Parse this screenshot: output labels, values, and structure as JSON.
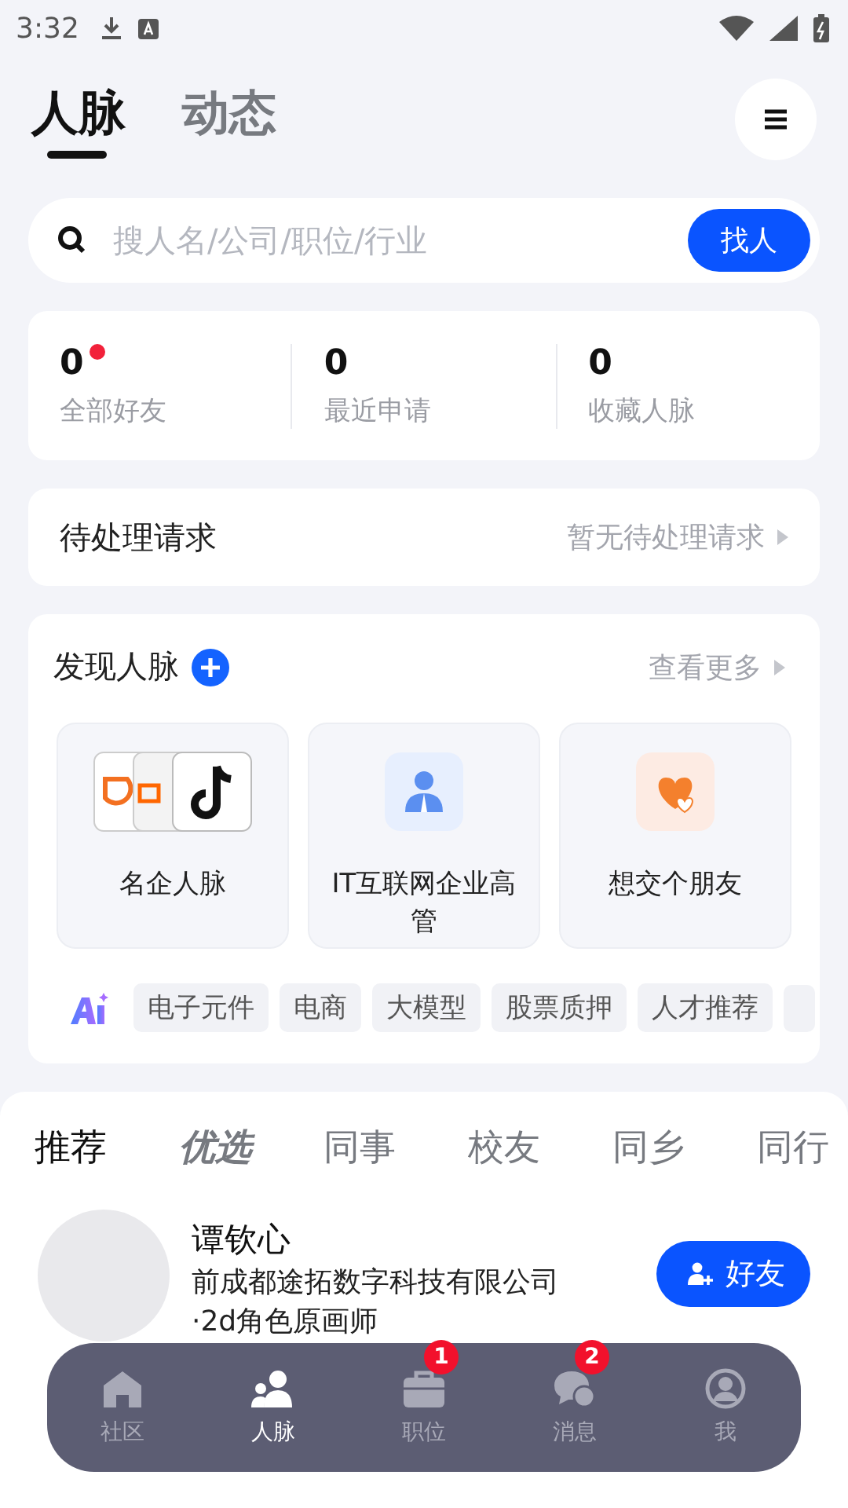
{
  "status_bar": {
    "time": "3:32"
  },
  "top_tabs": [
    {
      "label": "人脉",
      "selected": true
    },
    {
      "label": "动态",
      "selected": false
    }
  ],
  "search": {
    "placeholder": "搜人名/公司/职位/行业",
    "button": "找人"
  },
  "stats": [
    {
      "value": "0",
      "label": "全部好友",
      "dot": true
    },
    {
      "value": "0",
      "label": "最近申请",
      "dot": false
    },
    {
      "value": "0",
      "label": "收藏人脉",
      "dot": false
    }
  ],
  "pending": {
    "title": "待处理请求",
    "status": "暂无待处理请求"
  },
  "discover": {
    "title": "发现人脉",
    "more": "查看更多",
    "cards": [
      {
        "kind": "logos",
        "label": "名企人脉"
      },
      {
        "kind": "executive",
        "label": "IT互联网企业高管"
      },
      {
        "kind": "hearts",
        "label": "想交个朋友"
      }
    ],
    "tags": [
      "电子元件",
      "电商",
      "大模型",
      "股票质押",
      "人才推荐"
    ]
  },
  "feed_tabs": [
    {
      "label": "推荐",
      "selected": true,
      "kind": "plain"
    },
    {
      "label": "优选",
      "selected": false,
      "kind": "featured"
    },
    {
      "label": "同事",
      "selected": false,
      "kind": "plain"
    },
    {
      "label": "校友",
      "selected": false,
      "kind": "plain"
    },
    {
      "label": "同乡",
      "selected": false,
      "kind": "plain"
    },
    {
      "label": "同行",
      "selected": false,
      "kind": "plain"
    }
  ],
  "person": {
    "name": "谭钦心",
    "company": "前成都途拓数字科技有限公司",
    "role": "·2d角色原画师",
    "button": "好友"
  },
  "nav": [
    {
      "label": "社区",
      "selected": false,
      "kind": "home"
    },
    {
      "label": "人脉",
      "selected": true,
      "kind": "people"
    },
    {
      "label": "职位",
      "selected": false,
      "kind": "briefcase",
      "badge": "1"
    },
    {
      "label": "消息",
      "selected": false,
      "kind": "chat",
      "badge": "2"
    },
    {
      "label": "我",
      "selected": false,
      "kind": "profile"
    }
  ]
}
